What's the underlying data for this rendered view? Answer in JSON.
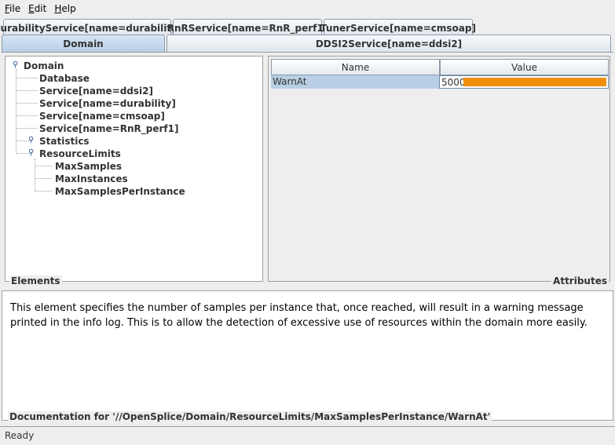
{
  "menu": {
    "file": {
      "mnemonic": "F",
      "rest": "ile"
    },
    "edit": {
      "mnemonic": "E",
      "rest": "dit"
    },
    "help": {
      "mnemonic": "H",
      "rest": "elp"
    }
  },
  "tabs_row1": [
    "DurabilityService[name=durability]",
    "RnRService[name=RnR_perf1]",
    "TunerService[name=cmsoap]"
  ],
  "tabs_row2": [
    "Domain",
    "DDSI2Service[name=ddsi2]"
  ],
  "selected_tab": "Domain",
  "tree": {
    "root": "Domain",
    "children": [
      "Database",
      "Service[name=ddsi2]",
      "Service[name=durability]",
      "Service[name=cmsoap]",
      "Service[name=RnR_perf1]",
      "Statistics",
      "ResourceLimits"
    ],
    "resource_limits_children": [
      "MaxSamples",
      "MaxInstances",
      "MaxSamplesPerInstance"
    ]
  },
  "elements_label": "Elements",
  "attributes_label": "Attributes",
  "attributes_table": {
    "columns": [
      "Name",
      "Value"
    ],
    "rows": [
      {
        "name": "WarnAt",
        "value": "5000"
      }
    ]
  },
  "documentation": {
    "text": "This element specifies the number of samples per instance that, once reached, will result in a warning message printed in the info log. This is to allow the detection of excessive use of resources within the domain more easily.",
    "label": "Documentation for '//OpenSplice/Domain/ResourceLimits/MaxSamplesPerInstance/WarnAt'"
  },
  "status": "Ready",
  "colors": {
    "selection": "#b8cfe5",
    "value_bar": "#f0900a",
    "tab_border": "#8d9aa8"
  }
}
